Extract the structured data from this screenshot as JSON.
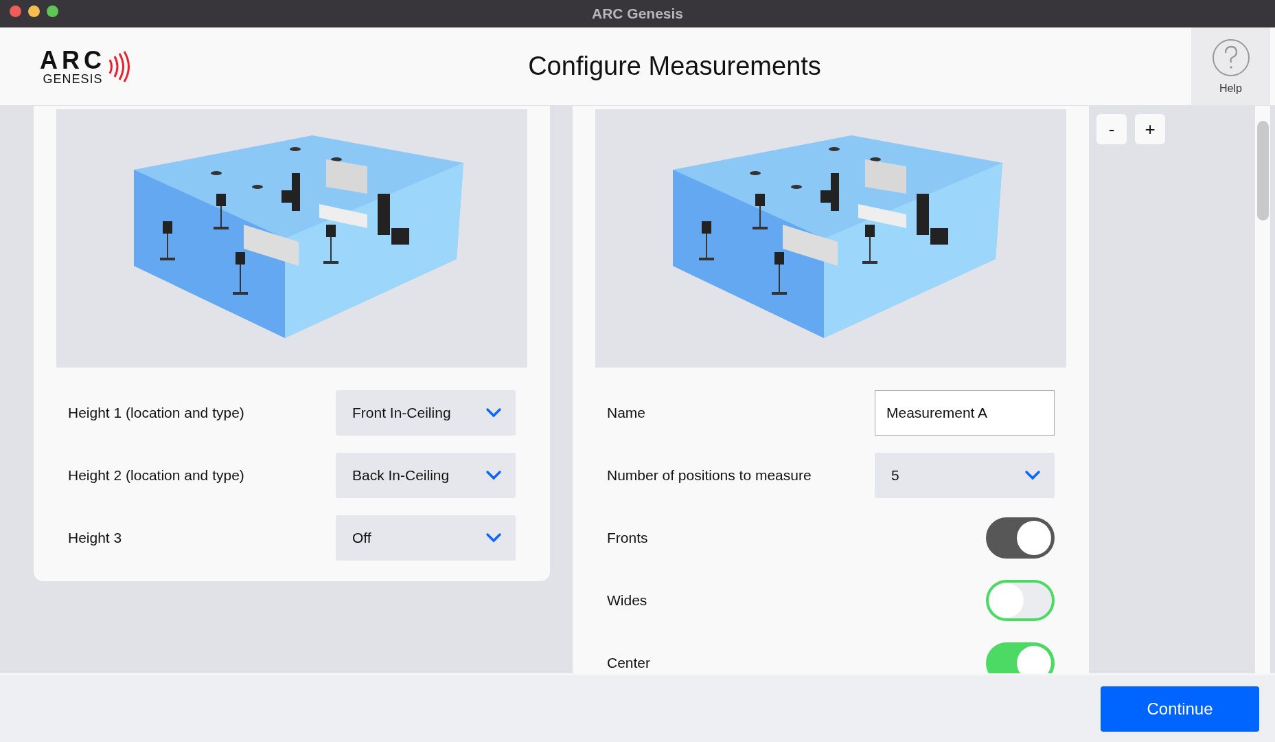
{
  "window": {
    "title": "ARC Genesis"
  },
  "header": {
    "logo_text": "ARC",
    "logo_subtext": "GENESIS",
    "title": "Configure Measurements",
    "help_label": "Help"
  },
  "zoom_buttons": [
    "-",
    "+"
  ],
  "left_panel": {
    "rows": [
      {
        "label": "Height 1 (location and type)",
        "value": "Front In-Ceiling"
      },
      {
        "label": "Height 2 (location and type)",
        "value": "Back In-Ceiling"
      },
      {
        "label": "Height 3",
        "value": "Off"
      }
    ]
  },
  "right_panel": {
    "rows": [
      {
        "kind": "text",
        "label": "Name",
        "value": "Measurement A"
      },
      {
        "kind": "select",
        "label": "Number of positions to measure",
        "value": "5"
      },
      {
        "kind": "toggle",
        "label": "Fronts",
        "on": true,
        "locked": true
      },
      {
        "kind": "toggle",
        "label": "Wides",
        "on": false,
        "locked": false
      },
      {
        "kind": "toggle",
        "label": "Center",
        "on": true,
        "locked": false
      }
    ]
  },
  "footer": {
    "continue_label": "Continue"
  }
}
